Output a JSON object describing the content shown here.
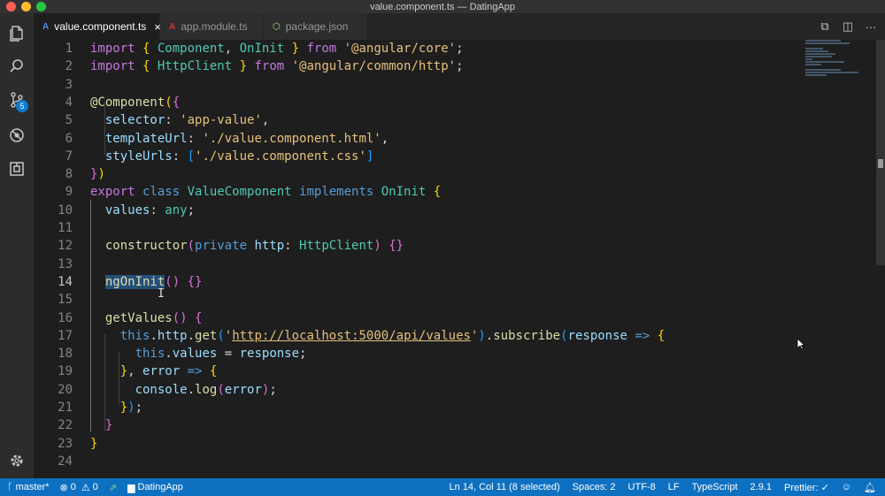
{
  "window": {
    "title": "value.component.ts — DatingApp"
  },
  "activity": {
    "scm_badge": "5"
  },
  "tabs": [
    {
      "label": "value.component.ts",
      "icon": "A",
      "close": "×"
    },
    {
      "label": "app.module.ts",
      "icon": "A"
    },
    {
      "label": "package.json",
      "icon": "⬡"
    }
  ],
  "editor_actions": [
    "⧉",
    "◫",
    "···"
  ],
  "lines": [
    {
      "n": "1",
      "t": [
        [
          "kw",
          "import "
        ],
        [
          "br1",
          "{ "
        ],
        [
          "cls",
          "Component"
        ],
        [
          "plain",
          ", "
        ],
        [
          "cls",
          "OnInit"
        ],
        [
          "br1",
          " } "
        ],
        [
          "kw",
          "from "
        ],
        [
          "str",
          "'@angular/core'"
        ],
        [
          "plain",
          ";"
        ]
      ]
    },
    {
      "n": "2",
      "t": [
        [
          "kw",
          "import "
        ],
        [
          "br1",
          "{ "
        ],
        [
          "cls",
          "HttpClient"
        ],
        [
          "br1",
          " } "
        ],
        [
          "kw",
          "from "
        ],
        [
          "str",
          "'@angular/common/http'"
        ],
        [
          "plain",
          ";"
        ]
      ]
    },
    {
      "n": "3",
      "t": []
    },
    {
      "n": "4",
      "t": [
        [
          "dec",
          "@Component"
        ],
        [
          "br1",
          "("
        ],
        [
          "br2",
          "{"
        ]
      ]
    },
    {
      "n": "5",
      "t": [
        [
          "plain",
          "  "
        ],
        [
          "var",
          "selector"
        ],
        [
          "plain",
          ": "
        ],
        [
          "str",
          "'app-value'"
        ],
        [
          "plain",
          ","
        ]
      ]
    },
    {
      "n": "6",
      "t": [
        [
          "plain",
          "  "
        ],
        [
          "var",
          "templateUrl"
        ],
        [
          "plain",
          ": "
        ],
        [
          "str",
          "'./value.component.html'"
        ],
        [
          "plain",
          ","
        ]
      ]
    },
    {
      "n": "7",
      "t": [
        [
          "plain",
          "  "
        ],
        [
          "var",
          "styleUrls"
        ],
        [
          "plain",
          ": "
        ],
        [
          "br3",
          "["
        ],
        [
          "str",
          "'./value.component.css'"
        ],
        [
          "br3",
          "]"
        ]
      ]
    },
    {
      "n": "8",
      "t": [
        [
          "br2",
          "}"
        ],
        [
          "br1",
          ")"
        ]
      ]
    },
    {
      "n": "9",
      "t": [
        [
          "kw",
          "export "
        ],
        [
          "ks",
          "class "
        ],
        [
          "cls",
          "ValueComponent "
        ],
        [
          "ks",
          "implements "
        ],
        [
          "cls",
          "OnInit "
        ],
        [
          "br1",
          "{"
        ]
      ]
    },
    {
      "n": "10",
      "t": [
        [
          "plain",
          "  "
        ],
        [
          "var",
          "values"
        ],
        [
          "plain",
          ": "
        ],
        [
          "cls",
          "any"
        ],
        [
          "plain",
          ";"
        ]
      ]
    },
    {
      "n": "11",
      "t": []
    },
    {
      "n": "12",
      "t": [
        [
          "plain",
          "  "
        ],
        [
          "fn",
          "constructor"
        ],
        [
          "br2",
          "("
        ],
        [
          "ks",
          "private "
        ],
        [
          "var",
          "http"
        ],
        [
          "plain",
          ": "
        ],
        [
          "cls",
          "HttpClient"
        ],
        [
          "br2",
          ")"
        ],
        [
          "plain",
          " "
        ],
        [
          "br2",
          "{}"
        ]
      ]
    },
    {
      "n": "13",
      "t": []
    },
    {
      "n": "14",
      "t": [
        [
          "plain",
          "  "
        ],
        [
          "fn sel",
          "ngOnInit"
        ],
        [
          "br2",
          "()"
        ],
        [
          "plain",
          " "
        ],
        [
          "br2",
          "{}"
        ]
      ]
    },
    {
      "n": "15",
      "t": []
    },
    {
      "n": "16",
      "t": [
        [
          "plain",
          "  "
        ],
        [
          "fn",
          "getValues"
        ],
        [
          "br2",
          "()"
        ],
        [
          "plain",
          " "
        ],
        [
          "br2",
          "{"
        ]
      ]
    },
    {
      "n": "17",
      "t": [
        [
          "plain",
          "    "
        ],
        [
          "ks",
          "this"
        ],
        [
          "plain",
          "."
        ],
        [
          "var",
          "http"
        ],
        [
          "plain",
          "."
        ],
        [
          "fn",
          "get"
        ],
        [
          "br3",
          "("
        ],
        [
          "str",
          "'"
        ],
        [
          "url",
          "http://localhost:5000/api/values"
        ],
        [
          "str",
          "'"
        ],
        [
          "br3",
          ")"
        ],
        [
          "plain",
          "."
        ],
        [
          "fn",
          "subscribe"
        ],
        [
          "br3",
          "("
        ],
        [
          "var",
          "response"
        ],
        [
          "plain",
          " "
        ],
        [
          "ks",
          "=>"
        ],
        [
          "plain",
          " "
        ],
        [
          "br1",
          "{"
        ]
      ]
    },
    {
      "n": "18",
      "t": [
        [
          "plain",
          "      "
        ],
        [
          "ks",
          "this"
        ],
        [
          "plain",
          "."
        ],
        [
          "var",
          "values"
        ],
        [
          "plain",
          " = "
        ],
        [
          "var",
          "response"
        ],
        [
          "plain",
          ";"
        ]
      ]
    },
    {
      "n": "19",
      "t": [
        [
          "plain",
          "    "
        ],
        [
          "br1",
          "}"
        ],
        [
          "plain",
          ", "
        ],
        [
          "var",
          "error"
        ],
        [
          "plain",
          " "
        ],
        [
          "ks",
          "=>"
        ],
        [
          "plain",
          " "
        ],
        [
          "br1",
          "{"
        ]
      ]
    },
    {
      "n": "20",
      "t": [
        [
          "plain",
          "      "
        ],
        [
          "var",
          "console"
        ],
        [
          "plain",
          "."
        ],
        [
          "fn",
          "log"
        ],
        [
          "br2",
          "("
        ],
        [
          "var",
          "error"
        ],
        [
          "br2",
          ")"
        ],
        [
          "plain",
          ";"
        ]
      ]
    },
    {
      "n": "21",
      "t": [
        [
          "plain",
          "    "
        ],
        [
          "br1",
          "}"
        ],
        [
          "br3",
          ")"
        ],
        [
          "plain",
          ";"
        ]
      ]
    },
    {
      "n": "22",
      "t": [
        [
          "plain",
          "  "
        ],
        [
          "br2",
          "}"
        ]
      ]
    },
    {
      "n": "23",
      "t": [
        [
          "br1",
          "}"
        ]
      ]
    },
    {
      "n": "24",
      "t": []
    }
  ],
  "status": {
    "branch": "master*",
    "errors": "0",
    "warnings": "0",
    "folder": "DatingApp",
    "position": "Ln 14, Col 11 (8 selected)",
    "spaces": "Spaces: 2",
    "encoding": "UTF-8",
    "eol": "LF",
    "language": "TypeScript",
    "version": "2.9.1",
    "prettier": "Prettier: ✓"
  }
}
